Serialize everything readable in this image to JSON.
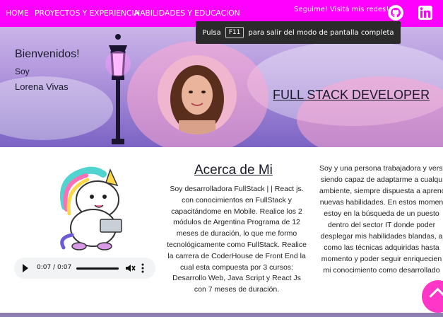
{
  "nav": {
    "items": [
      {
        "label": "HOME"
      },
      {
        "label": "PROYECTOS Y EXPERIENCIA"
      },
      {
        "label": "HABILIDADES Y EDUCACION"
      }
    ],
    "follow_text": "Seguime! Visitá mis redes!",
    "icons": [
      "github-icon",
      "linkedin-icon"
    ]
  },
  "hero": {
    "welcome": "Bienvenidos!",
    "soy": "Soy",
    "name": "Lorena Vivas",
    "title": "FULL STACK DEVELOPER"
  },
  "toast": {
    "prefix": "Pulsa",
    "key": "F11",
    "suffix": "para salir del modo de pantalla completa"
  },
  "about": {
    "title": "Acerca de Mi",
    "body": "Soy desarrolladora FullStack | | React js. con conocimientos en FullStack y capacitándome en Mobile. Realice los 2 módulos de Argentina Programa de 12 meses de duración, lo que me formo tecnológicamente como FullStack. Realice la carrera de CoderHouse de Front End la cual esta compuesta por 3 cursos: Desarrollo Web, Java Script y React Js con 7 meses de duración.",
    "side_lines": [
      "Soy y una persona trabajadora y versa",
      "siendo capaz de adaptarme a cualqu",
      "ambiente, siempre dispuesta a aprend",
      "nuevas habilidades. En estos momen",
      "estoy en la búsqueda de un puesto",
      "dentro del sector IT donde poder",
      "desplegar mis habilidades blandas, a",
      "como las técnicas adquiridas hasta",
      "momento y poder seguir enriquecien",
      "mi conocimiento como desarrollado"
    ]
  },
  "audio": {
    "time": "0:07 / 0:07"
  },
  "colors": {
    "nav_bg": "#ff00ff",
    "fab": "#ff36c8"
  }
}
